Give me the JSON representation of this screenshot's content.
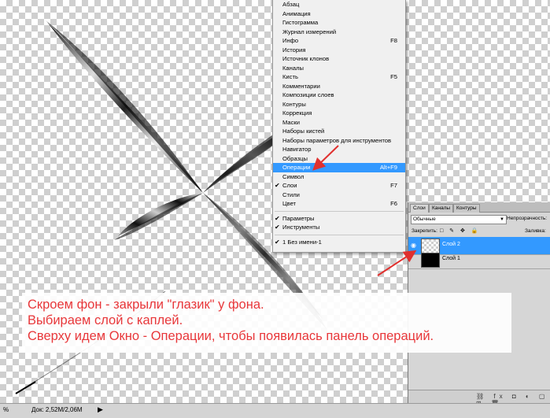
{
  "menu": {
    "items": [
      {
        "label": "Абзац",
        "shortcut": "",
        "checked": false,
        "highlighted": false
      },
      {
        "label": "Анимация",
        "shortcut": "",
        "checked": false,
        "highlighted": false
      },
      {
        "label": "Гистограмма",
        "shortcut": "",
        "checked": false,
        "highlighted": false
      },
      {
        "label": "Журнал измерений",
        "shortcut": "",
        "checked": false,
        "highlighted": false
      },
      {
        "label": "Инфо",
        "shortcut": "F8",
        "checked": false,
        "highlighted": false
      },
      {
        "label": "История",
        "shortcut": "",
        "checked": false,
        "highlighted": false
      },
      {
        "label": "Источник клонов",
        "shortcut": "",
        "checked": false,
        "highlighted": false
      },
      {
        "label": "Каналы",
        "shortcut": "",
        "checked": false,
        "highlighted": false
      },
      {
        "label": "Кисть",
        "shortcut": "F5",
        "checked": false,
        "highlighted": false
      },
      {
        "label": "Комментарии",
        "shortcut": "",
        "checked": false,
        "highlighted": false
      },
      {
        "label": "Композиции слоев",
        "shortcut": "",
        "checked": false,
        "highlighted": false
      },
      {
        "label": "Контуры",
        "shortcut": "",
        "checked": false,
        "highlighted": false
      },
      {
        "label": "Коррекция",
        "shortcut": "",
        "checked": false,
        "highlighted": false
      },
      {
        "label": "Маски",
        "shortcut": "",
        "checked": false,
        "highlighted": false
      },
      {
        "label": "Наборы кистей",
        "shortcut": "",
        "checked": false,
        "highlighted": false
      },
      {
        "label": "Наборы параметров для инструментов",
        "shortcut": "",
        "checked": false,
        "highlighted": false
      },
      {
        "label": "Навигатор",
        "shortcut": "",
        "checked": false,
        "highlighted": false
      },
      {
        "label": "Образцы",
        "shortcut": "",
        "checked": false,
        "highlighted": false
      },
      {
        "label": "Операции",
        "shortcut": "Alt+F9",
        "checked": false,
        "highlighted": true
      },
      {
        "label": "Символ",
        "shortcut": "",
        "checked": false,
        "highlighted": false
      },
      {
        "label": "Слои",
        "shortcut": "F7",
        "checked": true,
        "highlighted": false
      },
      {
        "label": "Стили",
        "shortcut": "",
        "checked": false,
        "highlighted": false
      },
      {
        "label": "Цвет",
        "shortcut": "F6",
        "checked": false,
        "highlighted": false
      }
    ],
    "options_group": [
      {
        "label": "Параметры",
        "checked": true
      },
      {
        "label": "Инструменты",
        "checked": true
      }
    ],
    "document_item": {
      "label": "1 Без имени-1",
      "checked": true
    }
  },
  "layers_panel": {
    "tabs": [
      "Слои",
      "Каналы",
      "Контуры"
    ],
    "active_tab": "Слои",
    "blend_mode": "Обычные",
    "opacity_label": "Непрозрачность:",
    "lock_label": "Закрепить:",
    "fill_label": "Заливка:",
    "lock_icons": "□ ✎ ✥ 🔒",
    "layers": [
      {
        "name": "Слой 2",
        "selected": true,
        "visible": true,
        "thumb": "transparent"
      },
      {
        "name": "Слой 1",
        "selected": false,
        "visible": false,
        "thumb": "black"
      }
    ],
    "footer_icons": "⛓ fx ◘ ◐ ▢ ⊞ 🗑"
  },
  "status_bar": {
    "zoom": "%",
    "doc_info": "Док: 2,52М/2,06М",
    "arrow": "▶"
  },
  "caption": [
    "Скроем фон - закрыли \"глазик\" у фона.",
    "Выбираем слой с каплей.",
    "Сверху идем Окно - Операции, чтобы появилась панель операций."
  ],
  "colors": {
    "caption_text": "#e8373a",
    "highlight": "#3399ff",
    "arrow": "#e0302e"
  }
}
